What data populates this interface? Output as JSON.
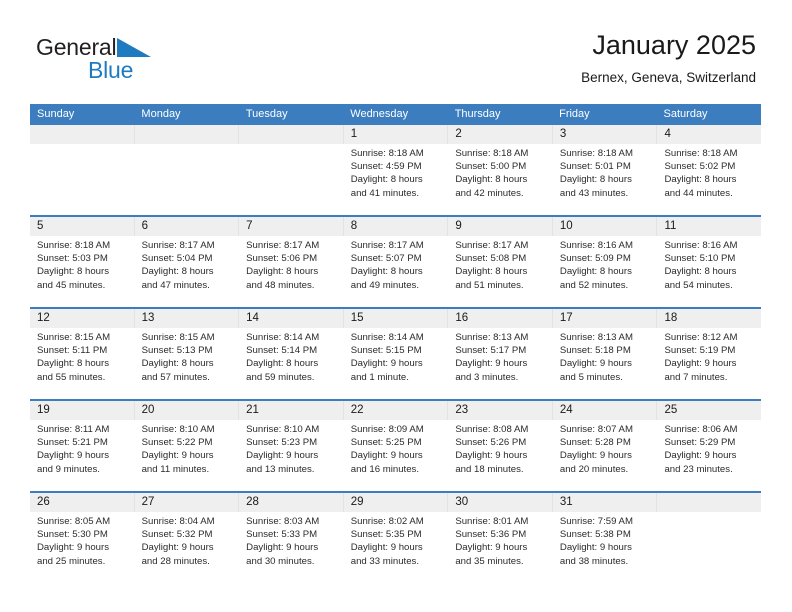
{
  "brand": {
    "name_dark": "General",
    "name_light": "Blue",
    "triangle_color": "#1f7bc1"
  },
  "header": {
    "title": "January 2025",
    "subtitle": "Bernex, Geneva, Switzerland"
  },
  "colors": {
    "header_blue": "#3b7dbf",
    "daynum_band": "#efefef",
    "text": "#1a1a1a"
  },
  "weekday_headers": [
    "Sunday",
    "Monday",
    "Tuesday",
    "Wednesday",
    "Thursday",
    "Friday",
    "Saturday"
  ],
  "weeks": [
    [
      {
        "day": "",
        "lines": []
      },
      {
        "day": "",
        "lines": []
      },
      {
        "day": "",
        "lines": []
      },
      {
        "day": "1",
        "lines": [
          "Sunrise: 8:18 AM",
          "Sunset: 4:59 PM",
          "Daylight: 8 hours",
          "and 41 minutes."
        ]
      },
      {
        "day": "2",
        "lines": [
          "Sunrise: 8:18 AM",
          "Sunset: 5:00 PM",
          "Daylight: 8 hours",
          "and 42 minutes."
        ]
      },
      {
        "day": "3",
        "lines": [
          "Sunrise: 8:18 AM",
          "Sunset: 5:01 PM",
          "Daylight: 8 hours",
          "and 43 minutes."
        ]
      },
      {
        "day": "4",
        "lines": [
          "Sunrise: 8:18 AM",
          "Sunset: 5:02 PM",
          "Daylight: 8 hours",
          "and 44 minutes."
        ]
      }
    ],
    [
      {
        "day": "5",
        "lines": [
          "Sunrise: 8:18 AM",
          "Sunset: 5:03 PM",
          "Daylight: 8 hours",
          "and 45 minutes."
        ]
      },
      {
        "day": "6",
        "lines": [
          "Sunrise: 8:17 AM",
          "Sunset: 5:04 PM",
          "Daylight: 8 hours",
          "and 47 minutes."
        ]
      },
      {
        "day": "7",
        "lines": [
          "Sunrise: 8:17 AM",
          "Sunset: 5:06 PM",
          "Daylight: 8 hours",
          "and 48 minutes."
        ]
      },
      {
        "day": "8",
        "lines": [
          "Sunrise: 8:17 AM",
          "Sunset: 5:07 PM",
          "Daylight: 8 hours",
          "and 49 minutes."
        ]
      },
      {
        "day": "9",
        "lines": [
          "Sunrise: 8:17 AM",
          "Sunset: 5:08 PM",
          "Daylight: 8 hours",
          "and 51 minutes."
        ]
      },
      {
        "day": "10",
        "lines": [
          "Sunrise: 8:16 AM",
          "Sunset: 5:09 PM",
          "Daylight: 8 hours",
          "and 52 minutes."
        ]
      },
      {
        "day": "11",
        "lines": [
          "Sunrise: 8:16 AM",
          "Sunset: 5:10 PM",
          "Daylight: 8 hours",
          "and 54 minutes."
        ]
      }
    ],
    [
      {
        "day": "12",
        "lines": [
          "Sunrise: 8:15 AM",
          "Sunset: 5:11 PM",
          "Daylight: 8 hours",
          "and 55 minutes."
        ]
      },
      {
        "day": "13",
        "lines": [
          "Sunrise: 8:15 AM",
          "Sunset: 5:13 PM",
          "Daylight: 8 hours",
          "and 57 minutes."
        ]
      },
      {
        "day": "14",
        "lines": [
          "Sunrise: 8:14 AM",
          "Sunset: 5:14 PM",
          "Daylight: 8 hours",
          "and 59 minutes."
        ]
      },
      {
        "day": "15",
        "lines": [
          "Sunrise: 8:14 AM",
          "Sunset: 5:15 PM",
          "Daylight: 9 hours",
          "and 1 minute."
        ]
      },
      {
        "day": "16",
        "lines": [
          "Sunrise: 8:13 AM",
          "Sunset: 5:17 PM",
          "Daylight: 9 hours",
          "and 3 minutes."
        ]
      },
      {
        "day": "17",
        "lines": [
          "Sunrise: 8:13 AM",
          "Sunset: 5:18 PM",
          "Daylight: 9 hours",
          "and 5 minutes."
        ]
      },
      {
        "day": "18",
        "lines": [
          "Sunrise: 8:12 AM",
          "Sunset: 5:19 PM",
          "Daylight: 9 hours",
          "and 7 minutes."
        ]
      }
    ],
    [
      {
        "day": "19",
        "lines": [
          "Sunrise: 8:11 AM",
          "Sunset: 5:21 PM",
          "Daylight: 9 hours",
          "and 9 minutes."
        ]
      },
      {
        "day": "20",
        "lines": [
          "Sunrise: 8:10 AM",
          "Sunset: 5:22 PM",
          "Daylight: 9 hours",
          "and 11 minutes."
        ]
      },
      {
        "day": "21",
        "lines": [
          "Sunrise: 8:10 AM",
          "Sunset: 5:23 PM",
          "Daylight: 9 hours",
          "and 13 minutes."
        ]
      },
      {
        "day": "22",
        "lines": [
          "Sunrise: 8:09 AM",
          "Sunset: 5:25 PM",
          "Daylight: 9 hours",
          "and 16 minutes."
        ]
      },
      {
        "day": "23",
        "lines": [
          "Sunrise: 8:08 AM",
          "Sunset: 5:26 PM",
          "Daylight: 9 hours",
          "and 18 minutes."
        ]
      },
      {
        "day": "24",
        "lines": [
          "Sunrise: 8:07 AM",
          "Sunset: 5:28 PM",
          "Daylight: 9 hours",
          "and 20 minutes."
        ]
      },
      {
        "day": "25",
        "lines": [
          "Sunrise: 8:06 AM",
          "Sunset: 5:29 PM",
          "Daylight: 9 hours",
          "and 23 minutes."
        ]
      }
    ],
    [
      {
        "day": "26",
        "lines": [
          "Sunrise: 8:05 AM",
          "Sunset: 5:30 PM",
          "Daylight: 9 hours",
          "and 25 minutes."
        ]
      },
      {
        "day": "27",
        "lines": [
          "Sunrise: 8:04 AM",
          "Sunset: 5:32 PM",
          "Daylight: 9 hours",
          "and 28 minutes."
        ]
      },
      {
        "day": "28",
        "lines": [
          "Sunrise: 8:03 AM",
          "Sunset: 5:33 PM",
          "Daylight: 9 hours",
          "and 30 minutes."
        ]
      },
      {
        "day": "29",
        "lines": [
          "Sunrise: 8:02 AM",
          "Sunset: 5:35 PM",
          "Daylight: 9 hours",
          "and 33 minutes."
        ]
      },
      {
        "day": "30",
        "lines": [
          "Sunrise: 8:01 AM",
          "Sunset: 5:36 PM",
          "Daylight: 9 hours",
          "and 35 minutes."
        ]
      },
      {
        "day": "31",
        "lines": [
          "Sunrise: 7:59 AM",
          "Sunset: 5:38 PM",
          "Daylight: 9 hours",
          "and 38 minutes."
        ]
      },
      {
        "day": "",
        "lines": []
      }
    ]
  ]
}
